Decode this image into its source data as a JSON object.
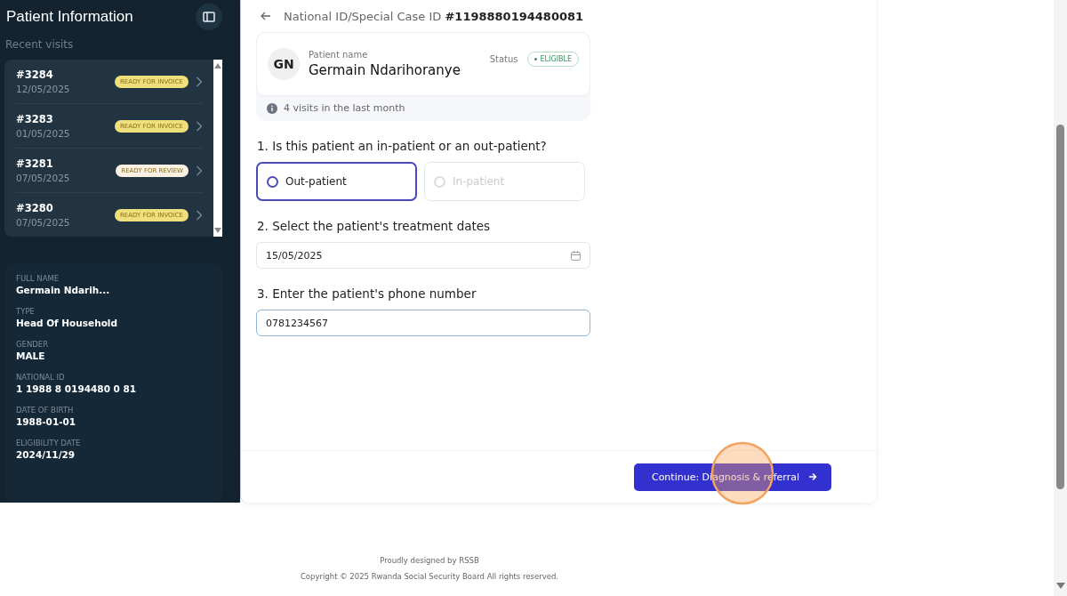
{
  "sidebar": {
    "title": "Patient Information",
    "subtitle": "Recent visits",
    "visits": [
      {
        "id": "#3284",
        "date": "12/05/2025",
        "status": "READY FOR INVOICE",
        "color": "#efe07c"
      },
      {
        "id": "#3283",
        "date": "01/05/2025",
        "status": "READY FOR INVOICE",
        "color": "#efe07c"
      },
      {
        "id": "#3281",
        "date": "07/05/2025",
        "status": "READY FOR REVIEW",
        "color": "#fdf1e1"
      },
      {
        "id": "#3280",
        "date": "07/05/2025",
        "status": "READY FOR INVOICE",
        "color": "#efe07c"
      }
    ],
    "details": [
      {
        "label": "FULL NAME",
        "value": "Germain Ndarih..."
      },
      {
        "label": "TYPE",
        "value": "Head Of Household"
      },
      {
        "label": "GENDER",
        "value": "MALE"
      },
      {
        "label": "NATIONAL ID",
        "value": "1 1988 8 0194480 0 81"
      },
      {
        "label": "DATE OF BIRTH",
        "value": "1988-01-01"
      },
      {
        "label": "ELIGIBILITY DATE",
        "value": "2024/11/29"
      }
    ]
  },
  "header": {
    "label": "National ID/Special Case ID",
    "id": "#1198880194480081"
  },
  "patient": {
    "initials": "GN",
    "name_label": "Patient name",
    "name": "Germain Ndarihoranye",
    "status_label": "Status",
    "status": "ELIGIBLE",
    "visits_note": "4 visits in the last month"
  },
  "questions": [
    {
      "kind": "radio",
      "label": "1. Is this patient an in-patient or an out-patient?",
      "options": [
        {
          "label": "Out-patient",
          "selected": true
        },
        {
          "label": "In-patient",
          "selected": false
        }
      ]
    },
    {
      "kind": "date",
      "label": "2. Select the patient's treatment dates",
      "value": "15/05/2025"
    },
    {
      "kind": "text",
      "label": "3. Enter the patient's phone number",
      "value": "0781234567"
    }
  ],
  "continue_button": "Continue: Diagnosis & referral",
  "footer": {
    "credit": "Proudly designed by RSSB",
    "copyright": "Copyright © 2025 Rwanda Social Security Board All rights reserved."
  }
}
